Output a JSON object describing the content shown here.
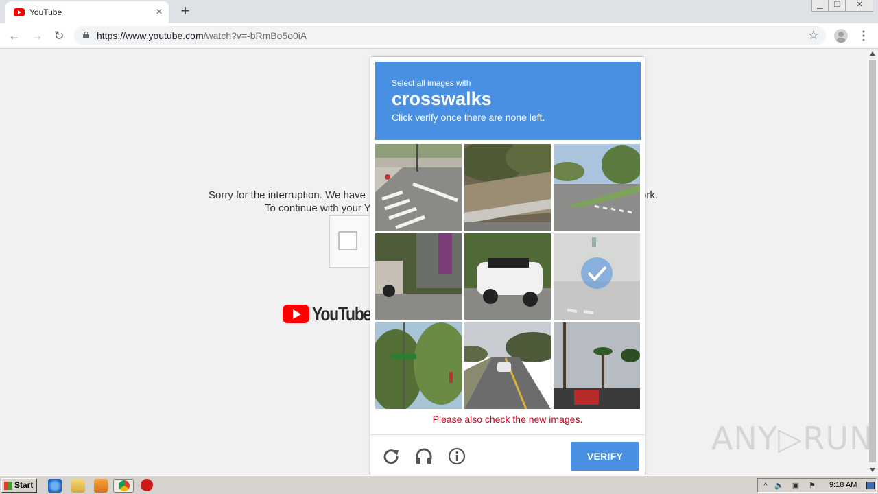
{
  "browser": {
    "tab_title": "YouTube",
    "tab_close": "×",
    "new_tab": "+",
    "window_controls": [
      "▁",
      "❐",
      "✕"
    ],
    "url_host": "https://www.youtube.com",
    "url_path": "/watch?v=-bRmBo5o0iA",
    "nav": {
      "back": "←",
      "forward": "→",
      "reload": "↻"
    },
    "star": "☆",
    "menu": "⋮"
  },
  "page": {
    "sorry_line1": "Sorry for the interruption. We have",
    "sorry_line1_tail": "ork.",
    "sorry_line2": "To continue with your Y",
    "logo_text": "YouTube"
  },
  "captcha": {
    "prompt_small": "Select all images with",
    "prompt_target": "crosswalks",
    "prompt_sub": "Click verify once there are none left.",
    "error_message": "Please also check the new images.",
    "verify_label": "VERIFY",
    "accent_color": "#4a90e2",
    "error_color": "#d0021b",
    "tiles": [
      {
        "subject": "crosswalk-street-corner",
        "selected": false
      },
      {
        "subject": "hillside-guardrail",
        "selected": false
      },
      {
        "subject": "intersection-crosswalk",
        "selected": false
      },
      {
        "subject": "parked-suv-fence",
        "selected": false
      },
      {
        "subject": "white-mini-car",
        "selected": false
      },
      {
        "subject": "faded-intersection",
        "selected": true
      },
      {
        "subject": "trees-street-sign",
        "selected": false
      },
      {
        "subject": "road-with-cars",
        "selected": false
      },
      {
        "subject": "palm-trees-gas-sign",
        "selected": false
      }
    ],
    "footer_icons": [
      "reload-icon",
      "audio-headphones-icon",
      "info-icon"
    ]
  },
  "watermark": "ANY▷RUN",
  "taskbar": {
    "start_label": "Start",
    "clock": "9:18 AM",
    "tray_icons": [
      "^",
      "🔈",
      "▣",
      "⚑"
    ]
  }
}
